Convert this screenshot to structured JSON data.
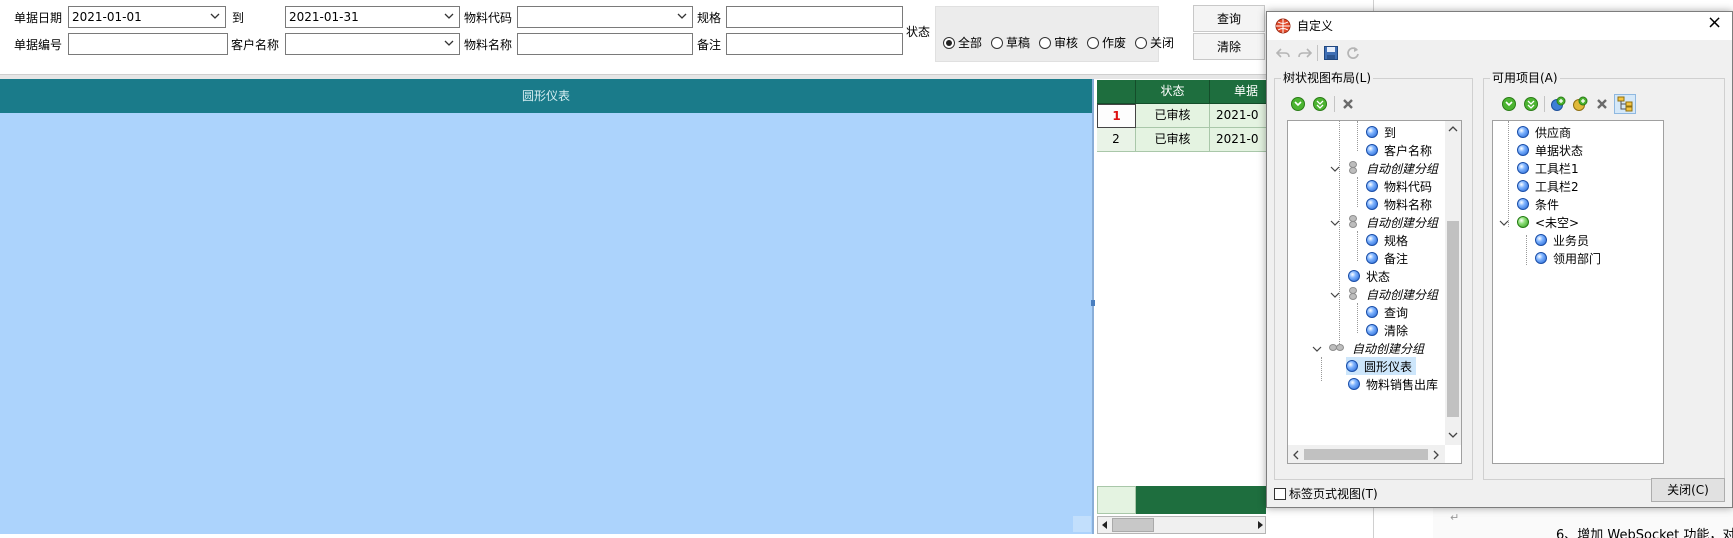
{
  "filters": {
    "date_label": "单据日期",
    "date_from": "2021-01-01",
    "to_label": "到",
    "date_to": "2021-01-31",
    "material_code_label": "物料代码",
    "material_code_value": "",
    "spec_label": "规格",
    "spec_value": "",
    "status_label": "状态",
    "doc_no_label": "单据编号",
    "doc_no_value": "",
    "customer_label": "客户名称",
    "customer_value": "",
    "material_name_label": "物料名称",
    "material_name_value": "",
    "remark_label": "备注",
    "remark_value": "",
    "status_options": [
      "全部",
      "草稿",
      "审核",
      "作废",
      "关闭"
    ],
    "status_selected": "全部"
  },
  "buttons": {
    "query": "查询",
    "clear": "清除"
  },
  "gauge_panel": {
    "title": "圆形仪表"
  },
  "grid": {
    "headers": [
      "状态",
      "单据"
    ],
    "rows": [
      {
        "no": "1",
        "status": "已审核",
        "doc": "2021-0"
      },
      {
        "no": "2",
        "status": "已审核",
        "doc": "2021-0"
      }
    ]
  },
  "background_doc": {
    "fragment": "6、增加 WebSocket 功能，对"
  },
  "dialog": {
    "title": "自定义",
    "close_glyph": "×",
    "left_section": "树状视图布局(L)",
    "right_section": "可用项目(A)",
    "left_tree": [
      {
        "label": "到",
        "kind": "item"
      },
      {
        "label": "客户名称",
        "kind": "item"
      },
      {
        "label": "自动创建分组",
        "kind": "group"
      },
      {
        "label": "物料代码",
        "kind": "item"
      },
      {
        "label": "物料名称",
        "kind": "item"
      },
      {
        "label": "自动创建分组",
        "kind": "group"
      },
      {
        "label": "规格",
        "kind": "item"
      },
      {
        "label": "备注",
        "kind": "item"
      },
      {
        "label": "状态",
        "kind": "item"
      },
      {
        "label": "自动创建分组",
        "kind": "group"
      },
      {
        "label": "查询",
        "kind": "item"
      },
      {
        "label": "清除",
        "kind": "item"
      },
      {
        "label": "自动创建分组",
        "kind": "group"
      },
      {
        "label": "圆形仪表",
        "kind": "item",
        "selected": true
      },
      {
        "label": "物料销售出库",
        "kind": "item"
      }
    ],
    "right_tree": [
      {
        "label": "供应商"
      },
      {
        "label": "单据状态"
      },
      {
        "label": "工具栏1"
      },
      {
        "label": "工具栏2"
      },
      {
        "label": "条件"
      },
      {
        "label": "<未空>"
      },
      {
        "label": "业务员"
      },
      {
        "label": "领用部门"
      }
    ],
    "tab_view_label": "标签页式视图(T)",
    "tab_view_checked": false,
    "close_button": "关闭(C)"
  },
  "colors": {
    "gauge_header": "#1a7b8a",
    "gauge_body": "#acd3fc",
    "grid_header": "#1e6e3e",
    "grid_row": "#e4f3e1",
    "selection": "#cde6fb"
  }
}
